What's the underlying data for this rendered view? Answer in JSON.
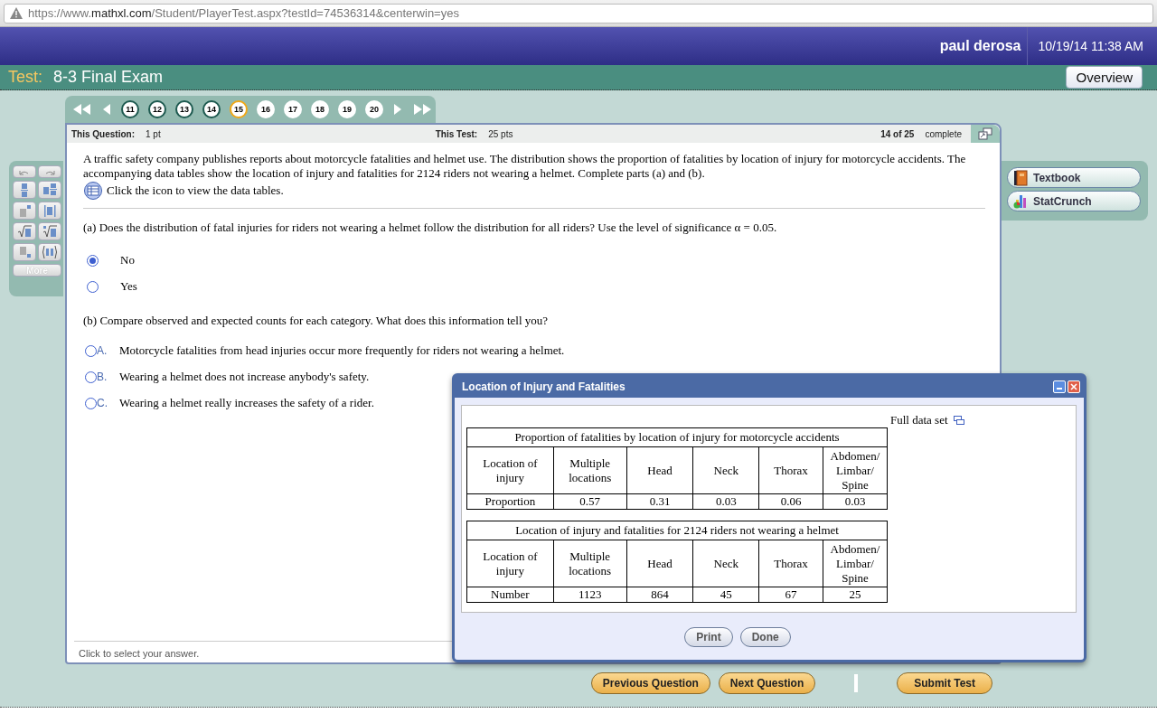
{
  "browser": {
    "url_start": "https://www.",
    "url_domain": "mathxl.com",
    "url_rest": "/Student/PlayerTest.aspx?testId=74536314&centerwin=yes"
  },
  "header": {
    "user": "paul derosa",
    "datetime": "10/19/14 11:38 AM"
  },
  "test_bar": {
    "label": "Test:",
    "title": "8-3 Final Exam",
    "overview_button": "Overview"
  },
  "question_nav": [
    {
      "number": "11",
      "answered": true,
      "selected": false
    },
    {
      "number": "12",
      "answered": true,
      "selected": false
    },
    {
      "number": "13",
      "answered": true,
      "selected": false
    },
    {
      "number": "14",
      "answered": true,
      "selected": false
    },
    {
      "number": "15",
      "answered": false,
      "selected": true
    },
    {
      "number": "16",
      "answered": false,
      "selected": false
    },
    {
      "number": "17",
      "answered": false,
      "selected": false
    },
    {
      "number": "18",
      "answered": false,
      "selected": false
    },
    {
      "number": "19",
      "answered": false,
      "selected": false
    },
    {
      "number": "20",
      "answered": false,
      "selected": false
    }
  ],
  "question_info": {
    "question_label": "This Question:",
    "question_points": "1 pt",
    "test_label": "This Test:",
    "test_points": "25 pts",
    "progress": "14 of 25",
    "progress_label": "complete"
  },
  "question": {
    "intro": "A traffic safety company publishes reports about motorcycle fatalities and helmet use. The distribution shows the proportion of fatalities by location of injury for motorcycle accidents. The accompanying data tables show the location of injury and fatalities for 2124 riders not wearing a helmet. Complete parts (a) and (b).",
    "data_link": "Click the icon to view the data tables.",
    "part_a": "(a) Does the distribution of fatal injuries for riders not wearing a helmet follow the distribution for all riders? Use the level of significance α = 0.05.",
    "part_a_options": [
      {
        "label": "No",
        "selected": true
      },
      {
        "label": "Yes",
        "selected": false
      }
    ],
    "part_b": "(b) Compare observed and expected counts for each category. What does this information tell you?",
    "part_b_options": [
      {
        "letter": "A.",
        "text": "Motorcycle fatalities from head injuries occur more frequently for riders not wearing a helmet.",
        "selected": false
      },
      {
        "letter": "B.",
        "text": "Wearing a helmet does not increase anybody's safety.",
        "selected": false
      },
      {
        "letter": "C.",
        "text": "Wearing a helmet really increases the safety of a rider.",
        "selected": false
      }
    ]
  },
  "status_hint": "Click to select your answer.",
  "palette": {
    "more": "More"
  },
  "tools": [
    {
      "label": "Textbook",
      "kind": "book"
    },
    {
      "label": "StatCrunch",
      "kind": "chart"
    }
  ],
  "dialog": {
    "title": "Location of Injury and Fatalities",
    "full_data_link": "Full data set",
    "tables": [
      {
        "caption": "Proportion of fatalities by location of injury for motorcycle accidents",
        "header": [
          "Location of injury",
          "Multiple locations",
          "Head",
          "Neck",
          "Thorax",
          "Abdomen/ Limbar/ Spine"
        ],
        "row": [
          "Proportion",
          "0.57",
          "0.31",
          "0.03",
          "0.06",
          "0.03"
        ]
      },
      {
        "caption": "Location of injury and fatalities for 2124 riders not wearing a helmet",
        "header": [
          "Location of injury",
          "Multiple locations",
          "Head",
          "Neck",
          "Thorax",
          "Abdomen/ Limbar/ Spine"
        ],
        "row": [
          "Number",
          "1123",
          "864",
          "45",
          "67",
          "25"
        ]
      }
    ],
    "buttons": [
      "Print",
      "Done"
    ]
  },
  "footer_buttons": [
    "Previous Question",
    "Next Question",
    "Submit Test"
  ]
}
